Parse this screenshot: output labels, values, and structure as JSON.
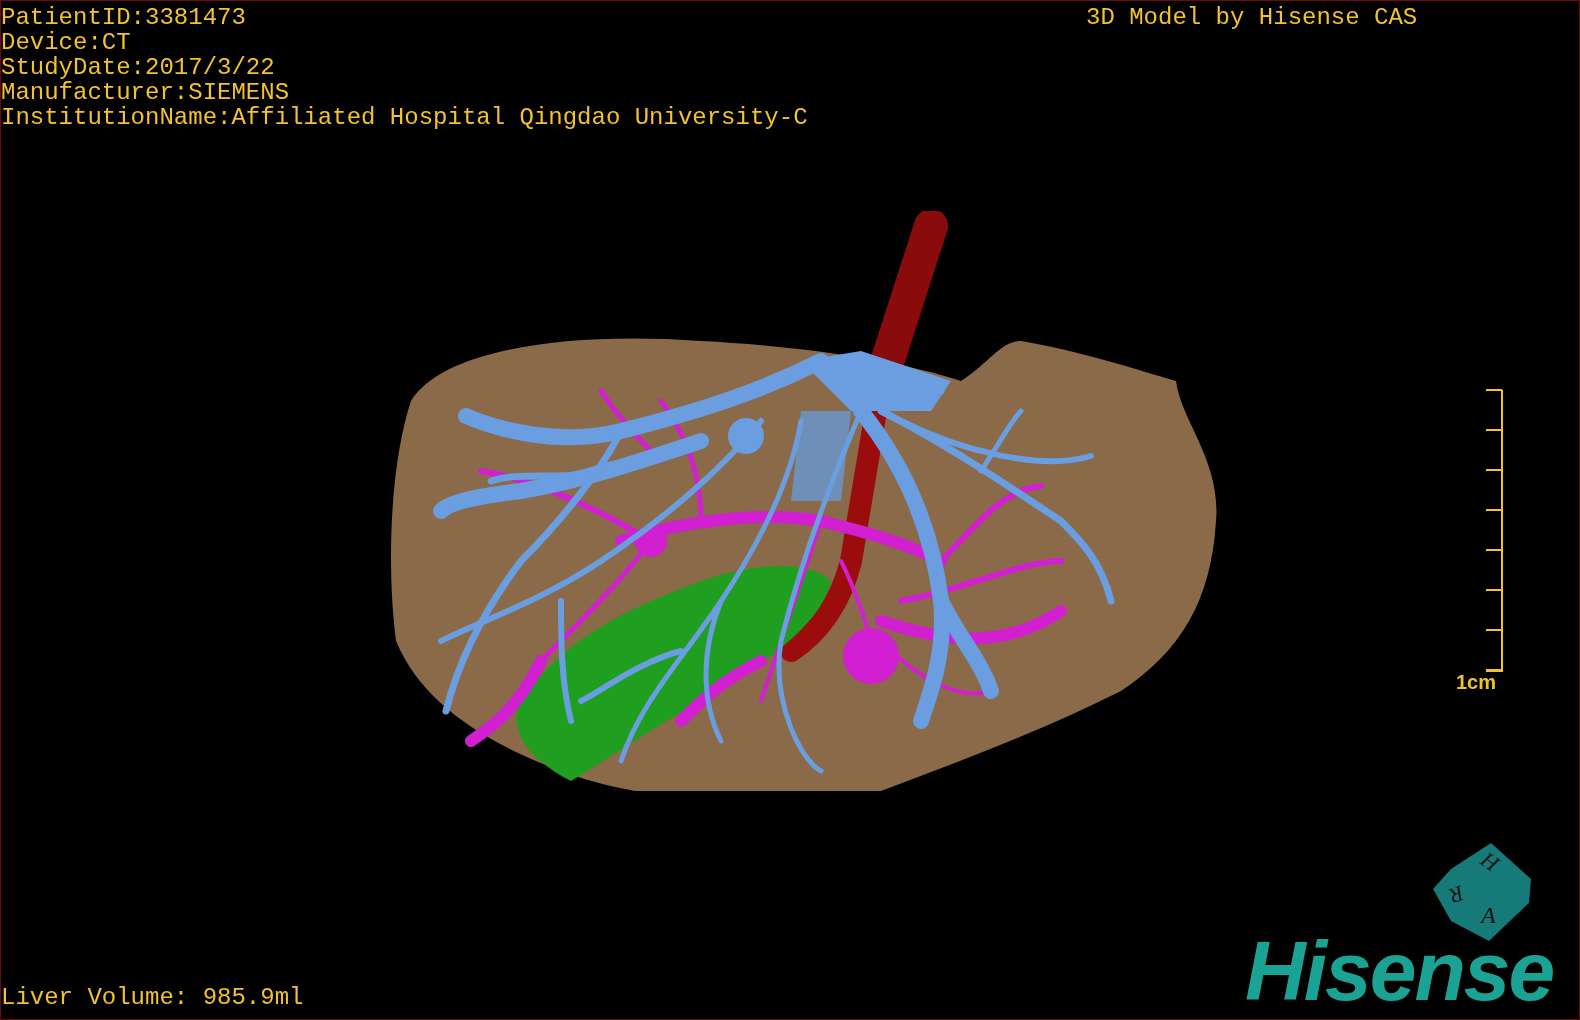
{
  "header": {
    "lines": [
      "PatientID:3381473",
      "Device:CT",
      "StudyDate:2017/3/22",
      "Manufacturer:SIEMENS",
      "InstitutionName:Affiliated Hospital Qingdao University-C"
    ]
  },
  "credit": "3D Model by Hisense CAS",
  "scale_bar": {
    "label": "1cm"
  },
  "orientation_cube": {
    "faces": [
      "H",
      "R",
      "A"
    ]
  },
  "logo": "Hisense",
  "footer": "Liver Volume: 985.9ml"
}
